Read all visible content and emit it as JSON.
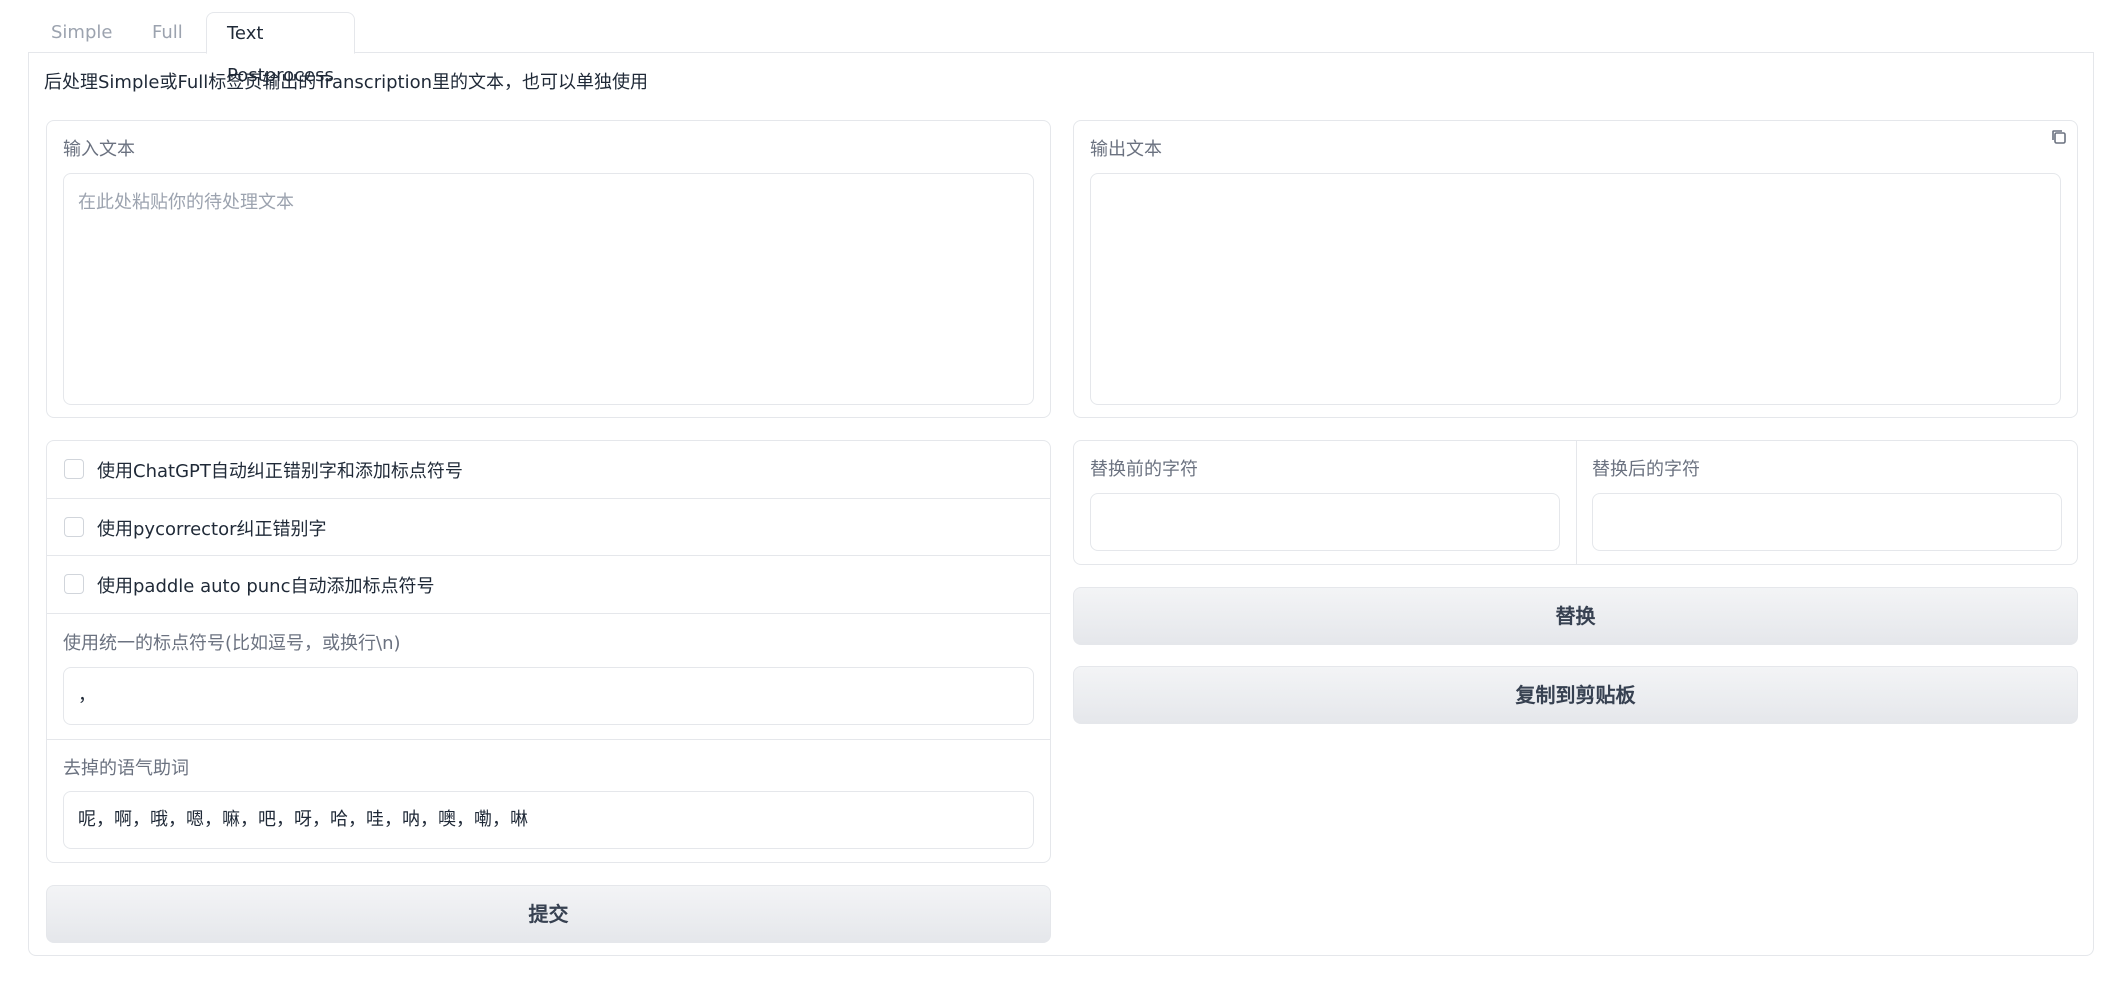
{
  "tabs": [
    {
      "label": "Simple",
      "active": false
    },
    {
      "label": "Full",
      "active": false
    },
    {
      "label": "Text Postprocess",
      "active": true
    }
  ],
  "description": "后处理Simple或Full标签页输出的Transcription里的文本，也可以单独使用",
  "input_text": {
    "label": "输入文本",
    "placeholder": "在此处粘贴你的待处理文本",
    "value": ""
  },
  "output_text": {
    "label": "输出文本",
    "value": "",
    "copy_icon": "copy-icon"
  },
  "options": [
    {
      "label": "使用ChatGPT自动纠正错别字和添加标点符号",
      "checked": false
    },
    {
      "label": "使用pycorrector纠正错别字",
      "checked": false
    },
    {
      "label": "使用paddle auto punc自动添加标点符号",
      "checked": false
    }
  ],
  "punctuation": {
    "label": "使用统一的标点符号(比如逗号，或换行\\n)",
    "value": "，"
  },
  "modal_particles": {
    "label": "去掉的语气助词",
    "value": "呢，啊，哦，嗯，嘛，吧，呀，哈，哇，呐，噢，嘞，啉"
  },
  "submit_label": "提交",
  "replace": {
    "before_label": "替换前的字符",
    "before_value": "",
    "after_label": "替换后的字符",
    "after_value": "",
    "button_label": "替换"
  },
  "copy_button_label": "复制到剪贴板"
}
